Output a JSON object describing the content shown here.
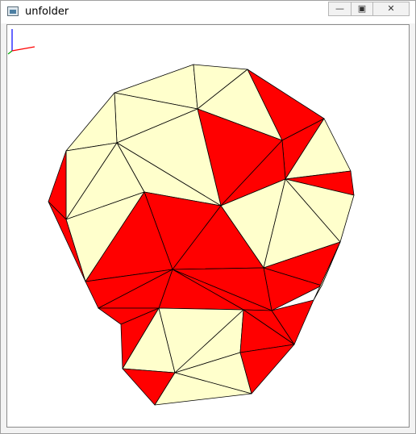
{
  "window": {
    "title": "unfolder",
    "icons": {
      "app": "app-window-icon",
      "minimize": "minimize-icon",
      "maximize": "maximize-icon",
      "close": "close-icon"
    },
    "glyphs": {
      "minimize": "—",
      "maximize": "▣",
      "close": "✕"
    }
  },
  "viewport": {
    "colors": {
      "face_light": "#ffffcc",
      "face_red": "#ff0000",
      "edge": "#000000",
      "background": "#ffffff"
    },
    "axes_indicator": {
      "x_color": "#ff0000",
      "y_color": "#0000ff",
      "z_color": "#00aa00"
    }
  }
}
